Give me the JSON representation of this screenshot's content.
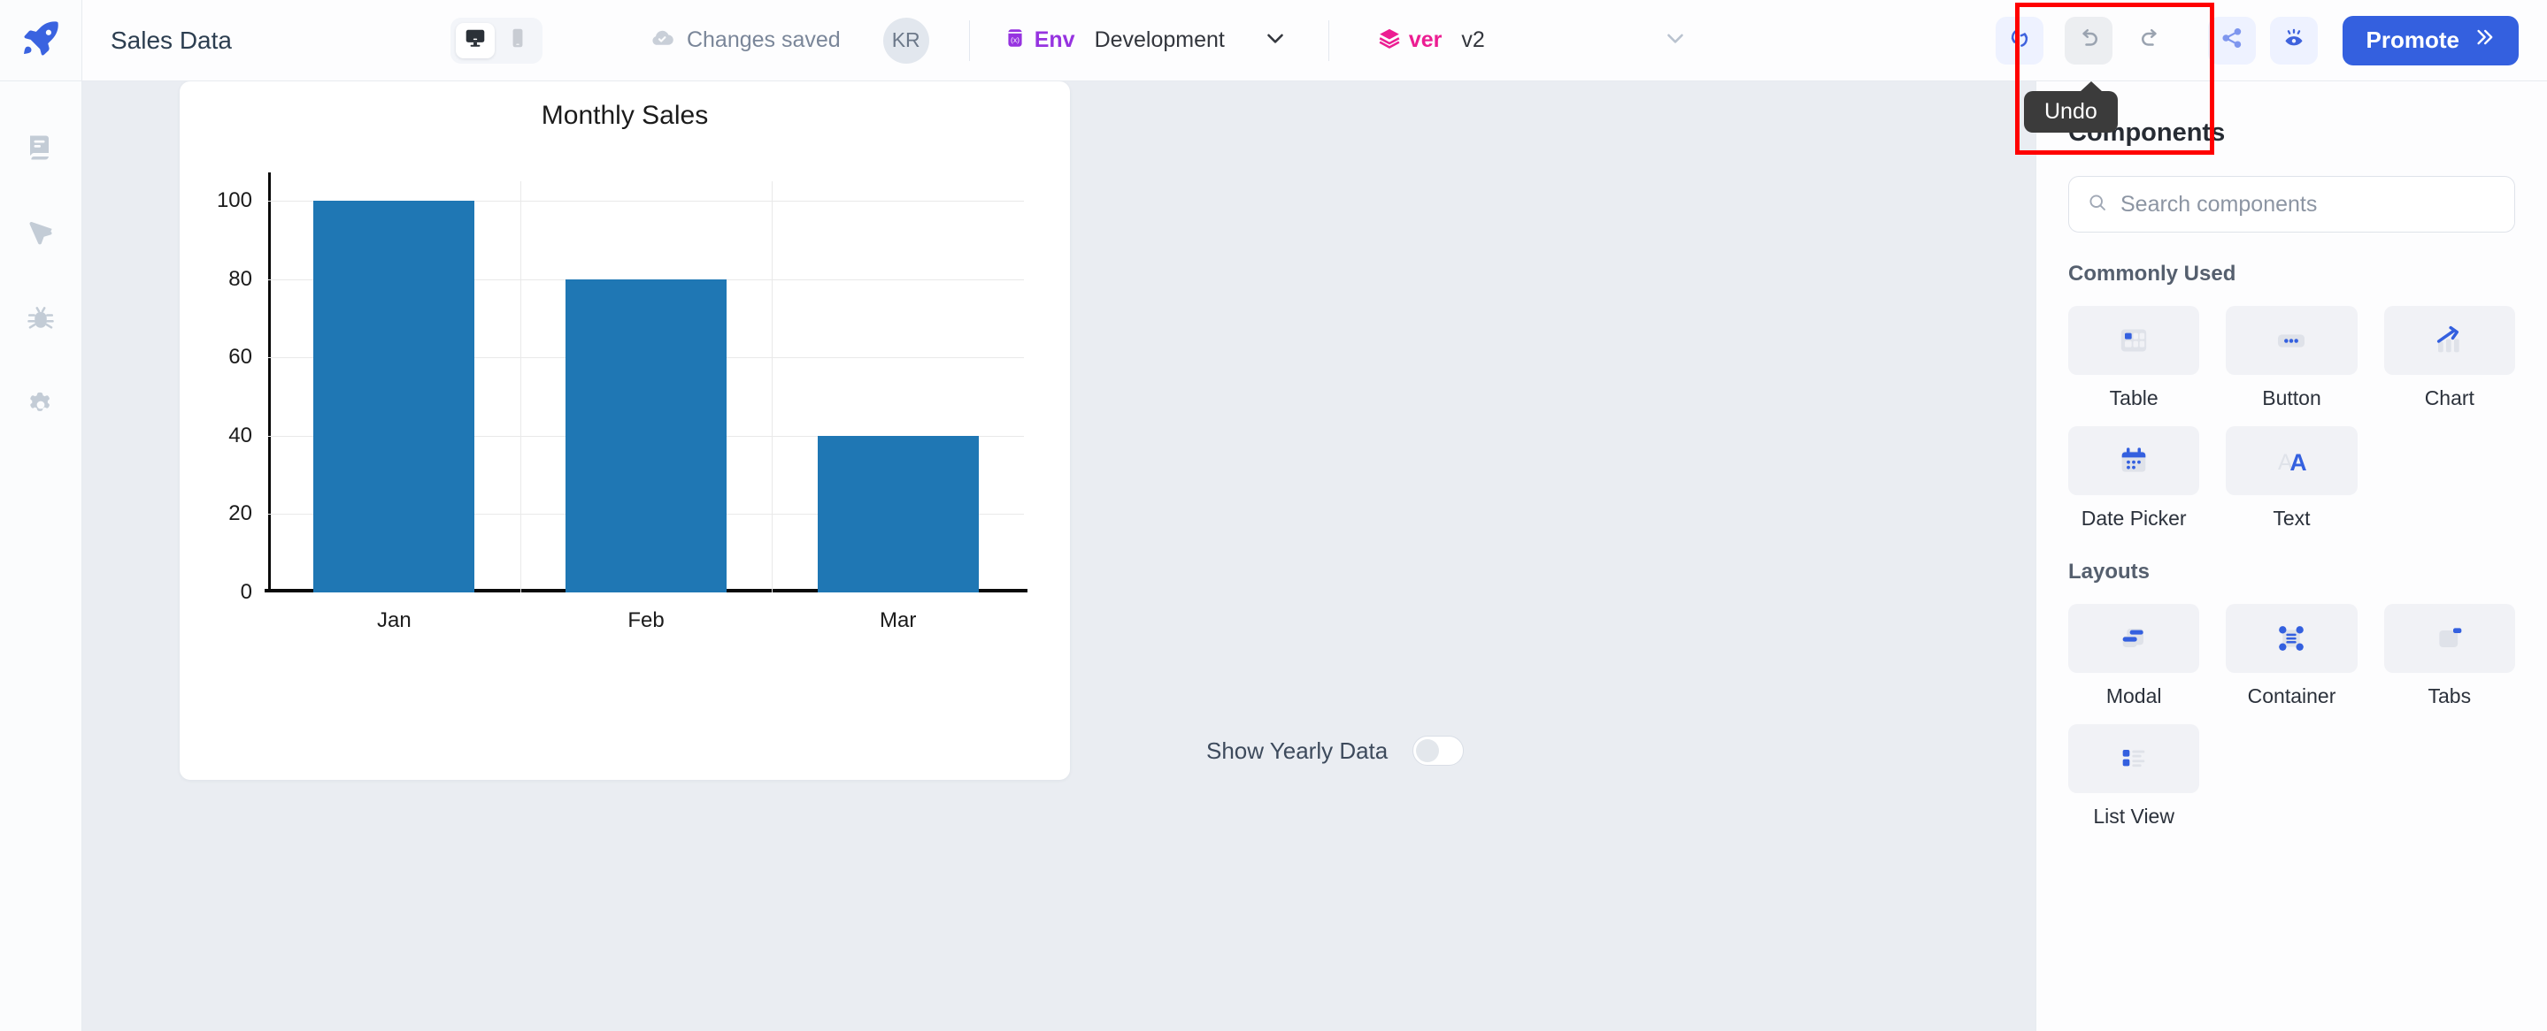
{
  "app": {
    "title": "Sales Data",
    "logo_icon": "rocket-icon"
  },
  "sidebar": {
    "items": [
      {
        "icon": "pages-icon",
        "name": "pages"
      },
      {
        "icon": "cursor-icon",
        "name": "inspector"
      },
      {
        "icon": "bug-icon",
        "name": "debugger"
      },
      {
        "icon": "gear-icon",
        "name": "settings"
      }
    ]
  },
  "topbar": {
    "device_toggle": {
      "desktop_icon": "desktop-icon",
      "mobile_icon": "mobile-icon",
      "selected": "desktop"
    },
    "save_status": "Changes saved",
    "save_status_icon": "cloud-check-icon",
    "avatar_initials": "KR",
    "env": {
      "tag": "Env",
      "value": "Development",
      "tag_color": "#9633e0",
      "icon": "env-variable-icon",
      "chevron_icon": "chevron-down-icon"
    },
    "version": {
      "tag": "ver",
      "value": "v2",
      "tag_color": "#ec1d92",
      "icon": "layers-icon",
      "chevron_icon": "chevron-down-icon"
    },
    "refresh_icon": "refresh-icon",
    "undo_icon": "undo-icon",
    "redo_icon": "redo-icon",
    "share_icon": "share-icon",
    "preview_icon": "preview-eye-icon",
    "promote_label": "Promote",
    "promote_chevron": "double-chevron-right-icon",
    "promote_color": "#3460df"
  },
  "tooltip": {
    "text": "Undo",
    "highlight_color": "#ff0000"
  },
  "canvas": {
    "toggle": {
      "label": "Show Yearly Data",
      "state": "off"
    }
  },
  "panel": {
    "heading": "Components",
    "search": {
      "placeholder": "Search components",
      "value": "",
      "icon": "search-icon"
    },
    "sections": [
      {
        "heading": "Commonly Used",
        "items": [
          {
            "label": "Table",
            "icon": "table-icon"
          },
          {
            "label": "Button",
            "icon": "button-icon"
          },
          {
            "label": "Chart",
            "icon": "chart-icon"
          },
          {
            "label": "Date Picker",
            "icon": "calendar-icon"
          },
          {
            "label": "Text",
            "icon": "text-icon"
          }
        ]
      },
      {
        "heading": "Layouts",
        "items": [
          {
            "label": "Modal",
            "icon": "modal-icon"
          },
          {
            "label": "Container",
            "icon": "container-icon"
          },
          {
            "label": "Tabs",
            "icon": "tabs-icon"
          },
          {
            "label": "List View",
            "icon": "list-view-icon"
          }
        ]
      }
    ]
  },
  "chart_data": {
    "type": "bar",
    "title": "Monthly Sales",
    "categories": [
      "Jan",
      "Feb",
      "Mar"
    ],
    "values": [
      100,
      80,
      40
    ],
    "xlabel": "",
    "ylabel": "",
    "ylim": [
      0,
      105
    ],
    "yticks": [
      0,
      20,
      40,
      60,
      80,
      100
    ],
    "grid": true,
    "legend": false,
    "bar_color": "#1f77b4"
  }
}
